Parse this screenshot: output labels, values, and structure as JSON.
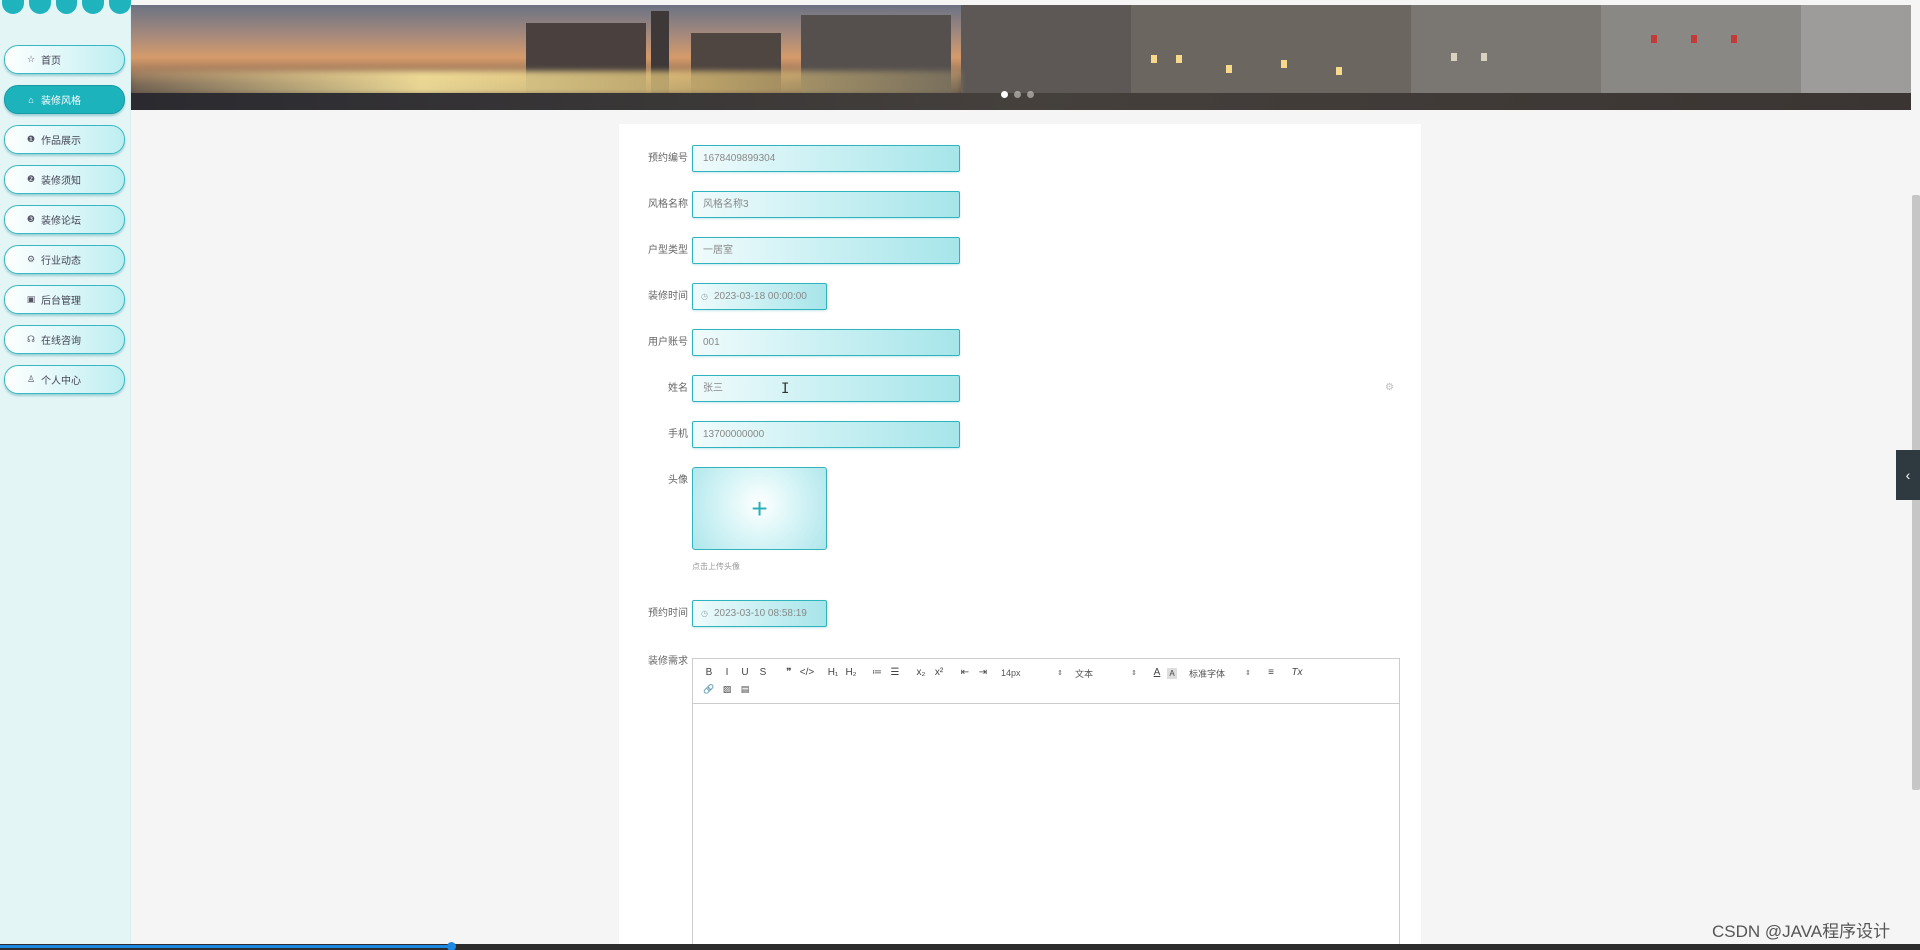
{
  "sidebar": {
    "items": [
      {
        "label": "首页",
        "icon": "star-icon",
        "glyph": "☆",
        "active": false
      },
      {
        "label": "装修风格",
        "icon": "home-icon",
        "glyph": "⌂",
        "active": true
      },
      {
        "label": "作品展示",
        "icon": "info-icon",
        "glyph": "❶",
        "active": false
      },
      {
        "label": "装修须知",
        "icon": "question-icon",
        "glyph": "❷",
        "active": false
      },
      {
        "label": "装修论坛",
        "icon": "forum-icon",
        "glyph": "❸",
        "active": false
      },
      {
        "label": "行业动态",
        "icon": "gear-icon",
        "glyph": "⚙",
        "active": false
      },
      {
        "label": "后台管理",
        "icon": "admin-icon",
        "glyph": "▣",
        "active": false
      },
      {
        "label": "在线咨询",
        "icon": "headset-icon",
        "glyph": "☊",
        "active": false
      },
      {
        "label": "个人中心",
        "icon": "user-icon",
        "glyph": "♙",
        "active": false
      }
    ]
  },
  "banner": {
    "slides": 3,
    "active_slide": 0
  },
  "form": {
    "reservation_no": {
      "label": "预约编号",
      "value": "1678409899304"
    },
    "style_name": {
      "label": "风格名称",
      "value": "风格名称3"
    },
    "house_type": {
      "label": "户型类型",
      "value": "一居室"
    },
    "renovation_time": {
      "label": "装修时间",
      "value": "2023-03-18 00:00:00"
    },
    "user_account": {
      "label": "用户账号",
      "value": "001"
    },
    "name": {
      "label": "姓名",
      "value": "张三"
    },
    "phone": {
      "label": "手机",
      "value": "13700000000"
    },
    "avatar": {
      "label": "头像",
      "plus": "+",
      "hint": "点击上传头像"
    },
    "reservation_time": {
      "label": "预约时间",
      "value": "2023-03-10 08:58:19"
    },
    "requirements": {
      "label": "装修需求"
    }
  },
  "editor": {
    "row1": [
      "B",
      "I",
      "U",
      "S",
      "❞",
      "</>",
      "H₁",
      "H₂",
      "≔",
      "☰",
      "x₂",
      "x²",
      "⇤",
      "⇥"
    ],
    "font_size": "14px",
    "text_type": "文本",
    "color_a": "A",
    "color_bg": "A",
    "font_family": "标准字体",
    "align": "≡",
    "clear": "Tx",
    "row2": [
      "🔗",
      "▨",
      "▤"
    ],
    "select_arrow": "⇕"
  },
  "side_tab": {
    "glyph": "‹"
  },
  "watermark": "CSDN @JAVA程序设计",
  "colors": {
    "accent": "#1cb3bd",
    "sidebar_bg": "#e4f5f6",
    "field_border": "#2fb4bd"
  },
  "video_progress": 0.235
}
